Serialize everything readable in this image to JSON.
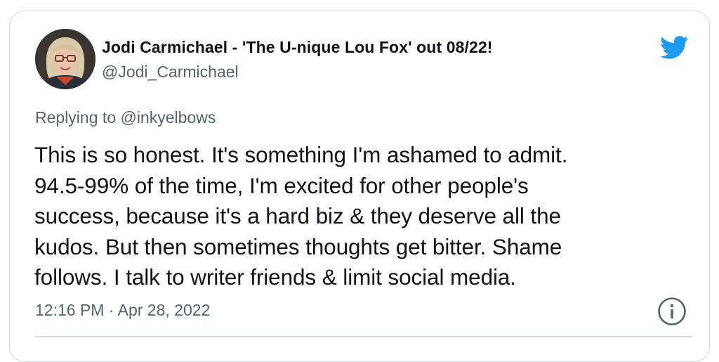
{
  "tweet": {
    "author": {
      "display_name": "Jodi Carmichael - 'The U-nique Lou Fox' out 08/22!",
      "handle": "@Jodi_Carmichael",
      "avatar_icon": "profile-photo"
    },
    "brand_icon": "twitter-bird-icon",
    "replying_prefix": "Replying to",
    "replying_to": "@inkyelbows",
    "text_lines": [
      "This is so honest. It's something I'm ashamed to admit.",
      "94.5-99% of the time, I'm excited for other people's",
      "success, because it's a hard biz & they deserve all the",
      "kudos. But then sometimes thoughts get bitter. Shame",
      "follows. I talk to writer friends & limit social media."
    ],
    "timestamp": "12:16 PM · Apr 28, 2022",
    "info_icon": "info-icon"
  },
  "colors": {
    "text": "#0f1419",
    "secondary": "#536471",
    "border": "#cfd9de",
    "twitter_blue": "#1d9bf0"
  }
}
